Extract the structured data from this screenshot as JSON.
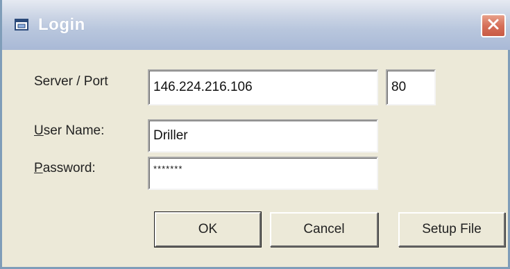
{
  "window": {
    "title": "Login",
    "icon": "window-icon",
    "close_icon": "close-icon"
  },
  "form": {
    "server_label": "Server / Port",
    "server_value": "146.224.216.106",
    "port_value": "80",
    "username_label_rest": "ser Name:",
    "username_label_key": "U",
    "username_value": "Driller",
    "password_label_key": "P",
    "password_label_rest": "assword:",
    "password_value": "*******"
  },
  "buttons": {
    "ok_label": "OK",
    "cancel_label": "Cancel",
    "setup_label": "Setup File"
  },
  "colors": {
    "titlebar": "#b8c6dd",
    "close_button": "#d6705a",
    "dialog_background": "#ece9d8"
  }
}
